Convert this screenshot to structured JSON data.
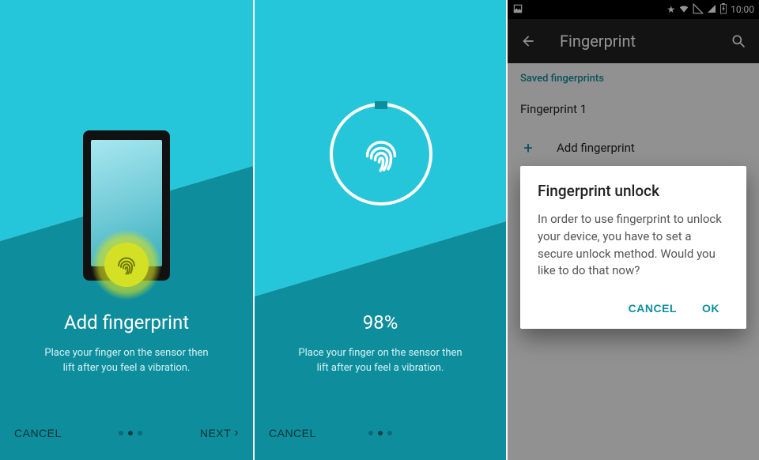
{
  "screen1": {
    "title": "Add fingerprint",
    "body": "Place your finger on the sensor then lift after you feel a vibration.",
    "cancel": "CANCEL",
    "next": "NEXT",
    "dots_total": 3,
    "active_dot": 1
  },
  "screen2": {
    "percent": "98%",
    "body": "Place your finger on the sensor then lift after you feel a vibration.",
    "cancel": "CANCEL",
    "dots_total": 3,
    "active_dot": 1
  },
  "screen3": {
    "status_time": "10:00",
    "toolbar_title": "Fingerprint",
    "subhead": "Saved fingerprints",
    "fingerprint_item": "Fingerprint 1",
    "add_label": "Add fingerprint",
    "dialog": {
      "title": "Fingerprint unlock",
      "body": "In order to use fingerprint to unlock your device, you have to set a secure unlock method. Would you like to do that now?",
      "cancel": "CANCEL",
      "ok": "OK"
    }
  }
}
